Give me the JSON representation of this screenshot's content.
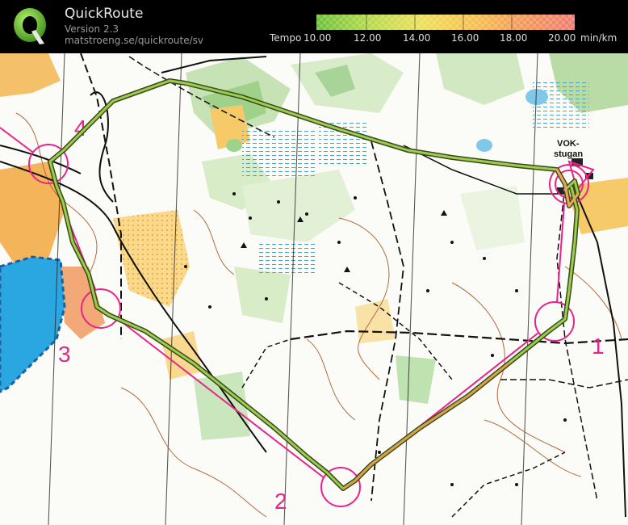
{
  "header": {
    "title": "QuickRoute",
    "version": "Version 2.3",
    "url": "matstroeng.se/quickroute/sv"
  },
  "legend": {
    "label": "Tempo",
    "ticks": [
      "10.00",
      "12.00",
      "14.00",
      "16.00",
      "18.00",
      "20.00"
    ],
    "unit": "min/km",
    "colors": [
      "#6cbf3a",
      "#b5d94a",
      "#ece05a",
      "#f6c24e",
      "#f29a5a",
      "#ee7e74"
    ]
  },
  "map": {
    "controls": [
      "1",
      "2",
      "3",
      "4"
    ],
    "place_label_line1": "VOK-",
    "place_label_line2": "stugan",
    "course_color": "#e8248b",
    "route_color": "#8ab83e"
  }
}
